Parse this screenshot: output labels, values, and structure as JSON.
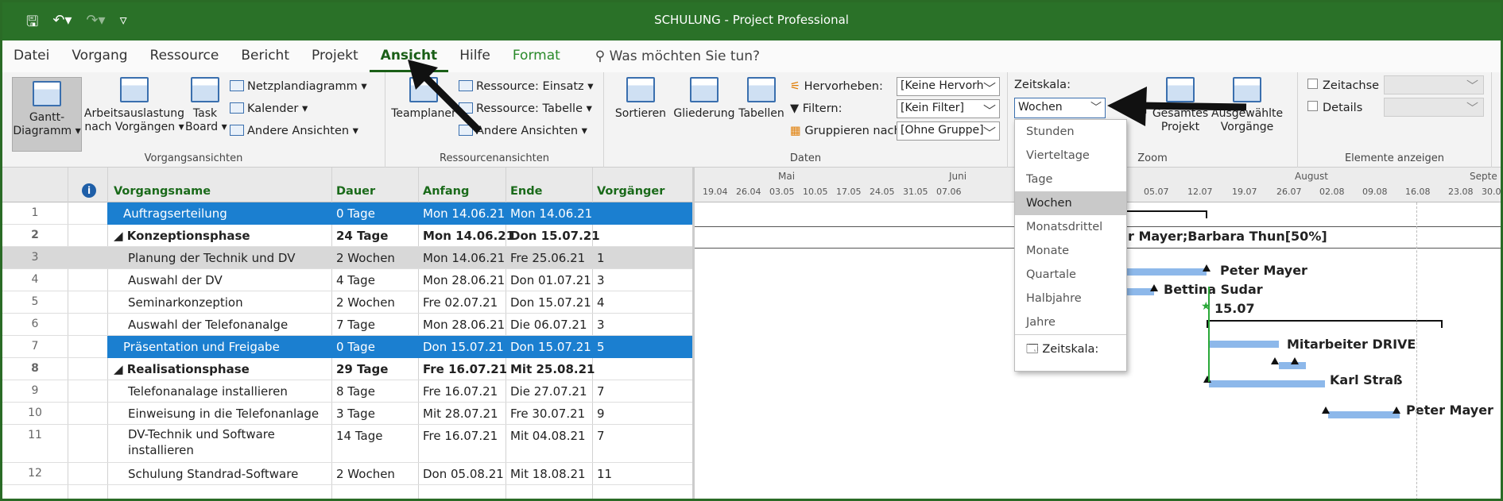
{
  "app": {
    "title": "SCHULUNG  -  Project Professional"
  },
  "menu": [
    "Datei",
    "Vorgang",
    "Ressource",
    "Bericht",
    "Projekt",
    "Ansicht",
    "Hilfe",
    "Format"
  ],
  "tell": "Was möchten Sie tun?",
  "ribbon": {
    "gantt": "Gantt-\nDiagramm ▾",
    "arbeit": "Arbeitsauslastung\nnach Vorgängen ▾",
    "task": "Task\nBoard ▾",
    "netz": "Netzplandiagramm ▾",
    "kalender": "Kalender ▾",
    "andere1": "Andere Ansichten ▾",
    "g1": "Vorgangsansichten",
    "teamplaner": "Teamplaner",
    "res_einsatz": "Ressource: Einsatz ▾",
    "res_tabelle": "Ressource: Tabelle ▾",
    "andere2": "Andere Ansichten ▾",
    "g2": "Ressourcenansichten",
    "sortieren": "Sortieren",
    "gliederung": "Gliederung",
    "tabellen": "Tabellen",
    "hervorheben": "Hervorheben:",
    "filtern": "Filtern:",
    "gruppieren": "Gruppieren nach:",
    "hv_val": "[Keine Hervorh",
    "fi_val": "[Kein Filter]",
    "gr_val": "[Ohne Gruppe]",
    "g3": "Daten",
    "zeitskala": "Zeitskala:",
    "zeitskala_val": "Wochen",
    "zoom_partial": "oom",
    "gesamtes": "Gesamtes\nProjekt",
    "ausgewaehlte": "Ausgewählte\nVorgänge",
    "g4": "Zoom",
    "zeitachse": "Zeitachse",
    "details": "Details",
    "g5": "Elemente anzeigen"
  },
  "dropdown": {
    "options": [
      "Stunden",
      "Vierteltage",
      "Tage",
      "Wochen",
      "Monatsdrittel",
      "Monate",
      "Quartale",
      "Halbjahre",
      "Jahre"
    ],
    "selected": "Wochen",
    "footer": "Zeitskala:"
  },
  "table": {
    "headers": [
      "Vorgangsname",
      "Dauer",
      "Anfang",
      "Ende",
      "Vorgänger"
    ],
    "rows": [
      {
        "n": "1",
        "name": "Auftragserteilung",
        "dur": "0 Tage",
        "start": "Mon 14.06.21",
        "end": "Mon 14.06.21",
        "pred": "",
        "style": "blue",
        "indent": 1
      },
      {
        "n": "2",
        "name": "◢ Konzeptionsphase",
        "dur": "24 Tage",
        "start": "Mon 14.06.21",
        "end": "Don 15.07.21",
        "pred": "",
        "style": "bold",
        "indent": 0
      },
      {
        "n": "3",
        "name": "Planung der Technik und DV",
        "dur": "2 Wochen",
        "start": "Mon 14.06.21",
        "end": "Fre 25.06.21",
        "pred": "1",
        "style": "sel",
        "indent": 2
      },
      {
        "n": "4",
        "name": "Auswahl der DV",
        "dur": "4 Tage",
        "start": "Mon 28.06.21",
        "end": "Don 01.07.21",
        "pred": "3",
        "style": "",
        "indent": 2
      },
      {
        "n": "5",
        "name": "Seminarkonzeption",
        "dur": "2 Wochen",
        "start": "Fre 02.07.21",
        "end": "Don 15.07.21",
        "pred": "4",
        "style": "",
        "indent": 2
      },
      {
        "n": "6",
        "name": "Auswahl der Telefonanalge",
        "dur": "7 Tage",
        "start": "Mon 28.06.21",
        "end": "Die 06.07.21",
        "pred": "3",
        "style": "",
        "indent": 2
      },
      {
        "n": "7",
        "name": "Präsentation und Freigabe",
        "dur": "0 Tage",
        "start": "Don 15.07.21",
        "end": "Don 15.07.21",
        "pred": "5",
        "style": "blue",
        "indent": 1
      },
      {
        "n": "8",
        "name": "◢ Realisationsphase",
        "dur": "29 Tage",
        "start": "Fre 16.07.21",
        "end": "Mit 25.08.21",
        "pred": "",
        "style": "bold",
        "indent": 0
      },
      {
        "n": "9",
        "name": "Telefonanalage installieren",
        "dur": "8 Tage",
        "start": "Fre 16.07.21",
        "end": "Die 27.07.21",
        "pred": "7",
        "style": "",
        "indent": 2
      },
      {
        "n": "10",
        "name": "Einweisung in die Telefonanlage",
        "dur": "3 Tage",
        "start": "Mit 28.07.21",
        "end": "Fre 30.07.21",
        "pred": "9",
        "style": "",
        "indent": 2
      },
      {
        "n": "11",
        "name": "DV-Technik und Software\ninstallieren",
        "dur": "14 Tage",
        "start": "Fre 16.07.21",
        "end": "Mit 04.08.21",
        "pred": "7",
        "style": "tall",
        "indent": 2
      },
      {
        "n": "12",
        "name": "Schulung Standrad-Software",
        "dur": "2 Wochen",
        "start": "Don 05.08.21",
        "end": "Mit 18.08.21",
        "pred": "11",
        "style": "",
        "indent": 2
      }
    ]
  },
  "gantt": {
    "months": [
      "Mai",
      "Juni",
      "li",
      "August",
      "Septe"
    ],
    "weeks": [
      "19.04",
      "26.04",
      "03.05",
      "10.05",
      "17.05",
      "24.05",
      "31.05",
      "07.06",
      "05.07",
      "12.07",
      "19.07",
      "26.07",
      "02.08",
      "09.08",
      "16.08",
      "23.08",
      "30.08"
    ],
    "labels": [
      "r Mayer;Barbara Thun[50%]",
      "Peter Mayer",
      "Bettina Sudar",
      "15.07",
      "Mitarbeiter DRIVE",
      "Karl Straß",
      "Peter Mayer"
    ]
  }
}
